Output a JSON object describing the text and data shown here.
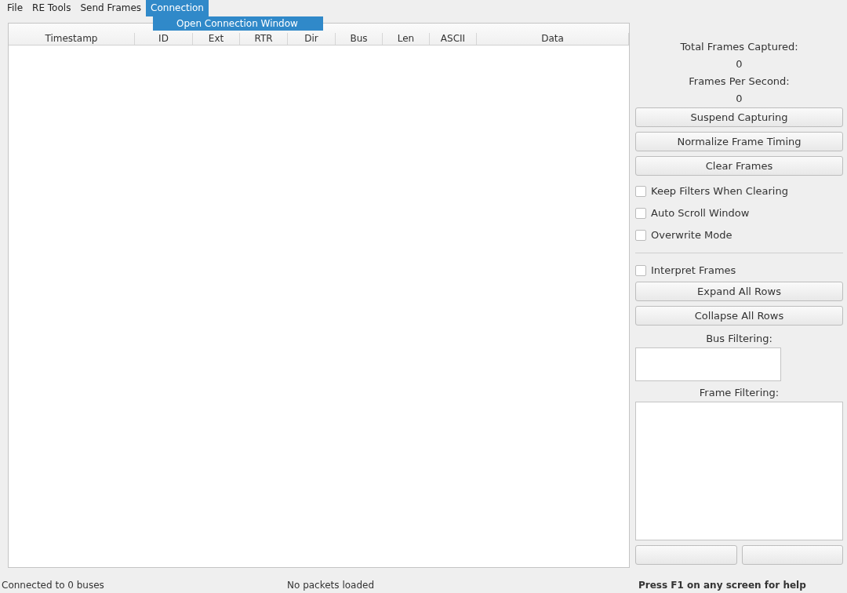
{
  "menubar": [
    {
      "label": "File",
      "selected": false
    },
    {
      "label": "RE Tools",
      "selected": false
    },
    {
      "label": "Send Frames",
      "selected": false
    },
    {
      "label": "Connection",
      "selected": true
    }
  ],
  "menu": {
    "items": [
      {
        "label": "Open Connection Window",
        "selected": true
      }
    ]
  },
  "table": {
    "columns": [
      "Timestamp",
      "ID",
      "Ext",
      "RTR",
      "Dir",
      "Bus",
      "Len",
      "ASCII",
      "Data"
    ]
  },
  "side": [
    {
      "kind": "label",
      "text": "Total Frames Captured:"
    },
    {
      "kind": "label",
      "text": "0"
    },
    {
      "kind": "label",
      "text": "Frames Per Second:"
    },
    {
      "kind": "label",
      "text": "0"
    },
    {
      "kind": "button",
      "text": "Suspend Capturing"
    },
    {
      "kind": "button",
      "text": "Normalize Frame Timing"
    },
    {
      "kind": "button",
      "text": "Clear Frames"
    },
    {
      "kind": "checkbox",
      "text": "Keep Filters When Clearing",
      "checked": false
    },
    {
      "kind": "checkbox",
      "text": "Auto Scroll Window",
      "checked": false
    },
    {
      "kind": "checkbox",
      "text": "Overwrite Mode",
      "checked": false
    },
    {
      "kind": "divider"
    },
    {
      "kind": "checkbox",
      "text": "Interpret Frames",
      "checked": false
    },
    {
      "kind": "button",
      "text": "Expand All Rows"
    },
    {
      "kind": "button",
      "text": "Collapse All Rows"
    },
    {
      "kind": "label",
      "text": "Bus Filtering:"
    },
    {
      "kind": "smalllist"
    },
    {
      "kind": "label",
      "text": "Frame Filtering:"
    },
    {
      "kind": "biglist"
    },
    {
      "kind": "buttonpair"
    }
  ],
  "status_bar": {
    "left": "Connected to 0 buses",
    "center": "No packets loaded",
    "right": "Press F1 on any screen for help"
  }
}
